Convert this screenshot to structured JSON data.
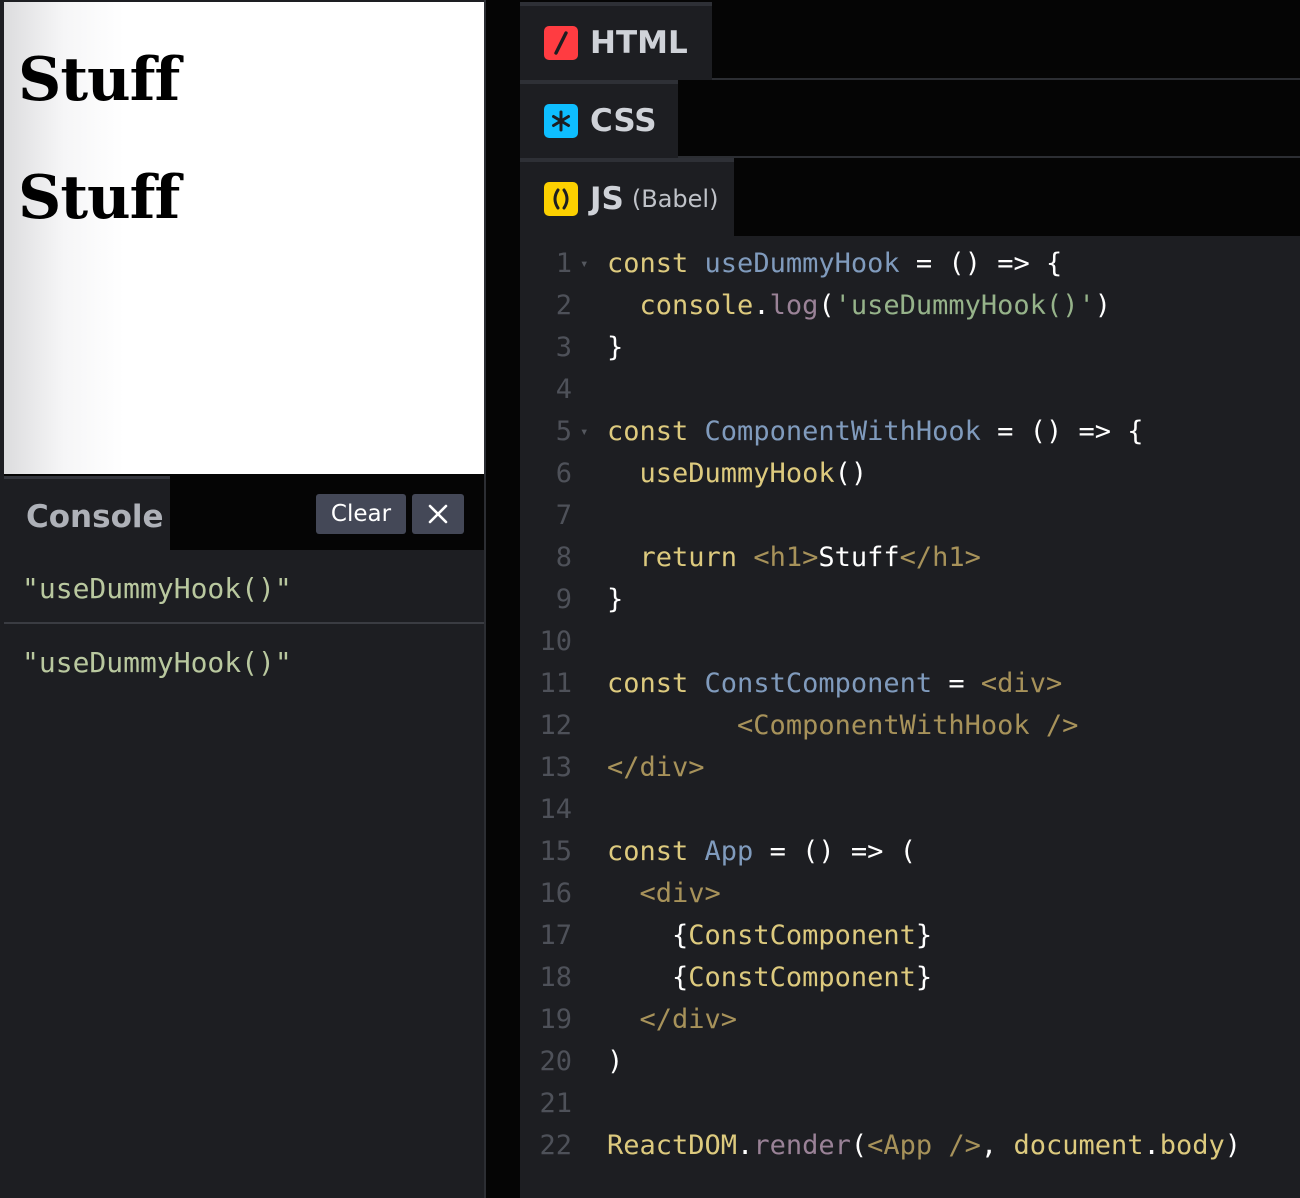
{
  "preview": {
    "headings": [
      "Stuff",
      "Stuff"
    ]
  },
  "console": {
    "tab_label": "Console",
    "clear_label": "Clear",
    "close_icon": "close-icon",
    "logs": [
      "\"useDummyHook()\"",
      "\"useDummyHook()\""
    ]
  },
  "editors": {
    "html": {
      "label": "HTML",
      "icon": "html-slash-icon",
      "color": "#ff3c41"
    },
    "css": {
      "label": "CSS",
      "icon": "css-asterisk-icon",
      "color": "#0ebeff"
    },
    "js": {
      "label": "JS",
      "sublabel": "(Babel)",
      "icon": "js-parens-icon",
      "color": "#fcd000"
    }
  },
  "code": {
    "line_numbers": [
      "1",
      "2",
      "3",
      "4",
      "5",
      "6",
      "7",
      "8",
      "9",
      "10",
      "11",
      "12",
      "13",
      "14",
      "15",
      "16",
      "17",
      "18",
      "19",
      "20",
      "21",
      "22"
    ],
    "lines": [
      "const useDummyHook = () => {",
      "  console.log('useDummyHook()')",
      "}",
      "",
      "const ComponentWithHook = () => {",
      "  useDummyHook()",
      "",
      "  return <h1>Stuff</h1>",
      "}",
      "",
      "const ConstComponent = <div>",
      "        <ComponentWithHook />",
      "</div>",
      "",
      "const App = () => (",
      "  <div>",
      "    {ConstComponent}",
      "    {ConstComponent}",
      "  </div>",
      ")",
      "",
      "ReactDOM.render(<App />, document.body)"
    ]
  }
}
